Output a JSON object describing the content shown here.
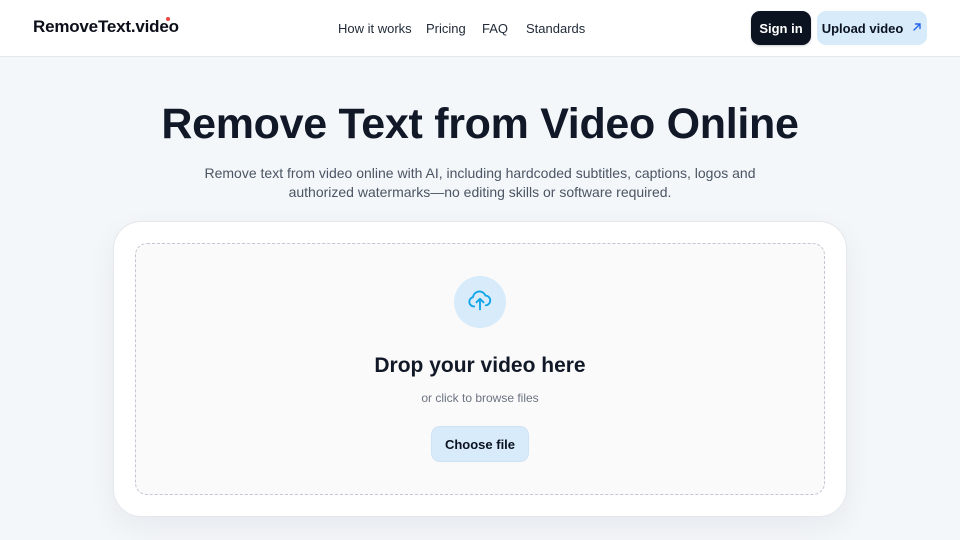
{
  "header": {
    "logo": "RemoveText.video",
    "nav": [
      "How it works",
      "Pricing",
      "FAQ",
      "Standards"
    ],
    "signin_label": "Sign in",
    "upload_label": "Upload video"
  },
  "hero": {
    "title": "Remove Text from Video Online",
    "subtitle_line1": "Remove text from video online with AI, including hardcoded subtitles, captions, logos and",
    "subtitle_line2": "authorized watermarks—no editing skills or software required."
  },
  "uploader": {
    "icon": "cloud-upload-icon",
    "title": "Drop your video here",
    "hint": "or click to browse files",
    "choose_label": "Choose file"
  },
  "colors": {
    "accent_light": "#d7ebfa",
    "icon_blue": "#0ea5e9",
    "dark_button": "#0b1220",
    "logo_dot": "#ef4444"
  }
}
